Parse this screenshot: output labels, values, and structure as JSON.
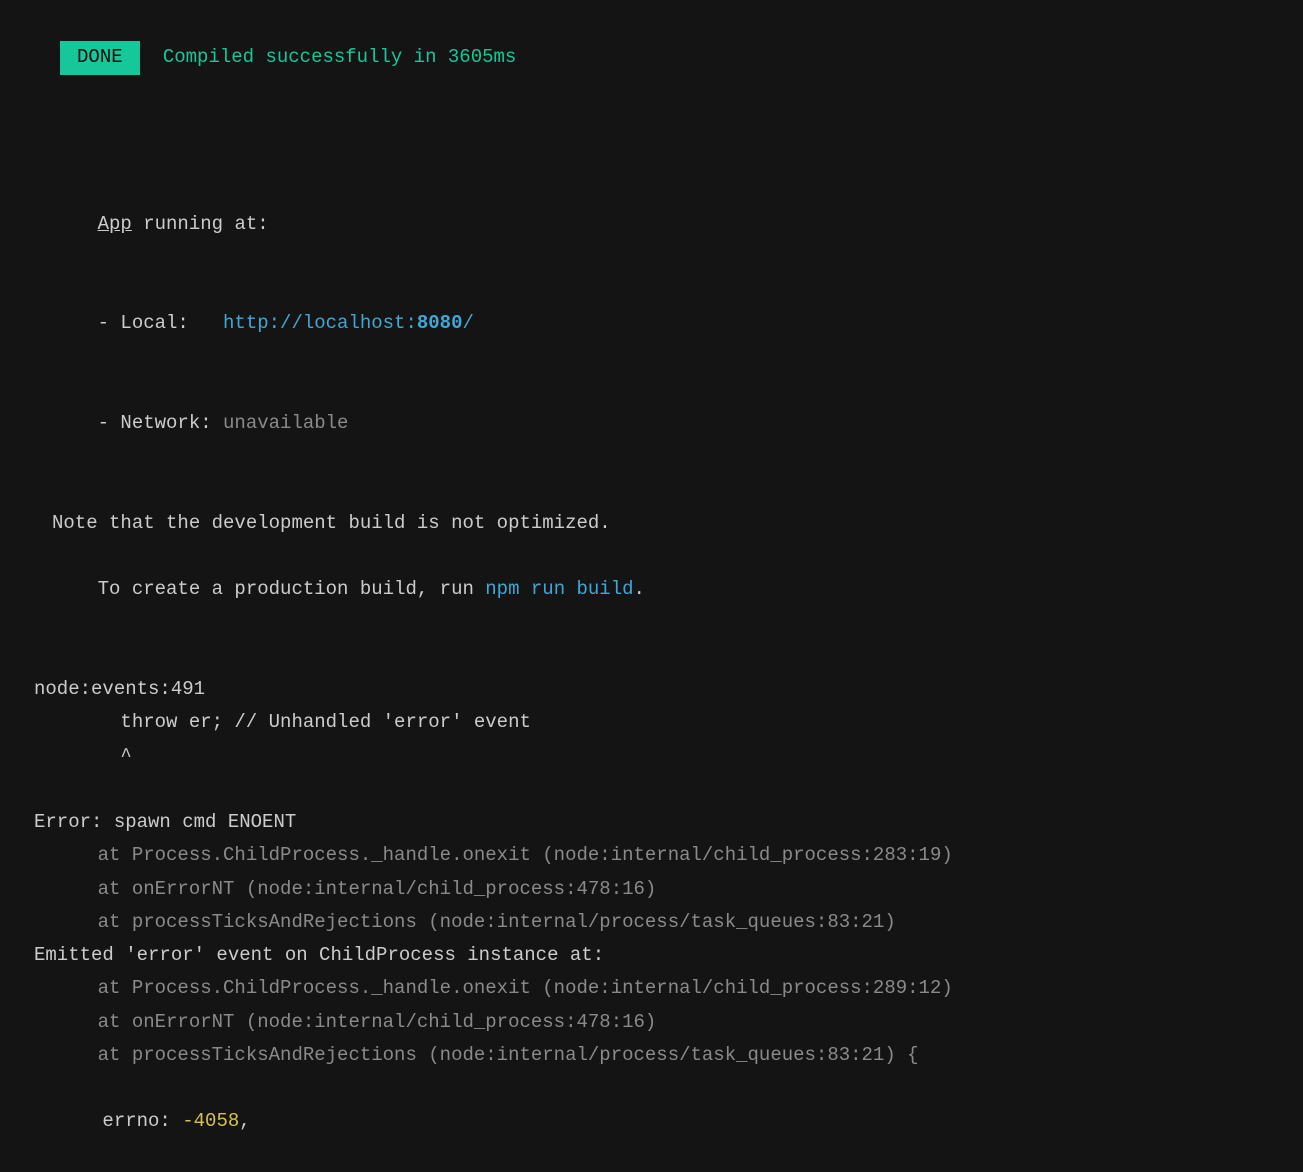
{
  "status": {
    "badge": " DONE ",
    "message": "Compiled successfully in 3605ms"
  },
  "app_running": {
    "heading_word": "App",
    "heading_rest": " running at:",
    "local_label": "- Local:   ",
    "local_url_prefix": "http://localhost:",
    "local_url_port": "8080",
    "local_url_suffix": "/",
    "network_label": "- Network: ",
    "network_value": "unavailable"
  },
  "note": {
    "line1": "Note that the development build is not optimized.",
    "line2_prefix": "To create a production build, run ",
    "line2_command": "npm run build",
    "line2_suffix": "."
  },
  "error": {
    "events_header": "node:events:491",
    "throw_line": "      throw er; // Unhandled 'error' event",
    "caret_line": "      ^",
    "title": "Error: spawn cmd ENOENT",
    "stack1": [
      "    at Process.ChildProcess._handle.onexit (node:internal/child_process:283:19)",
      "    at onErrorNT (node:internal/child_process:478:16)",
      "    at processTicksAndRejections (node:internal/process/task_queues:83:21)"
    ],
    "emitted_header": "Emitted 'error' event on ChildProcess instance at:",
    "stack2": [
      "    at Process.ChildProcess._handle.onexit (node:internal/child_process:289:12)",
      "    at onErrorNT (node:internal/child_process:478:16)",
      "    at processTicksAndRejections (node:internal/process/task_queues:83:21) {"
    ],
    "errno_label": "  errno: ",
    "errno_value": "-4058",
    "errno_suffix": ","
  }
}
